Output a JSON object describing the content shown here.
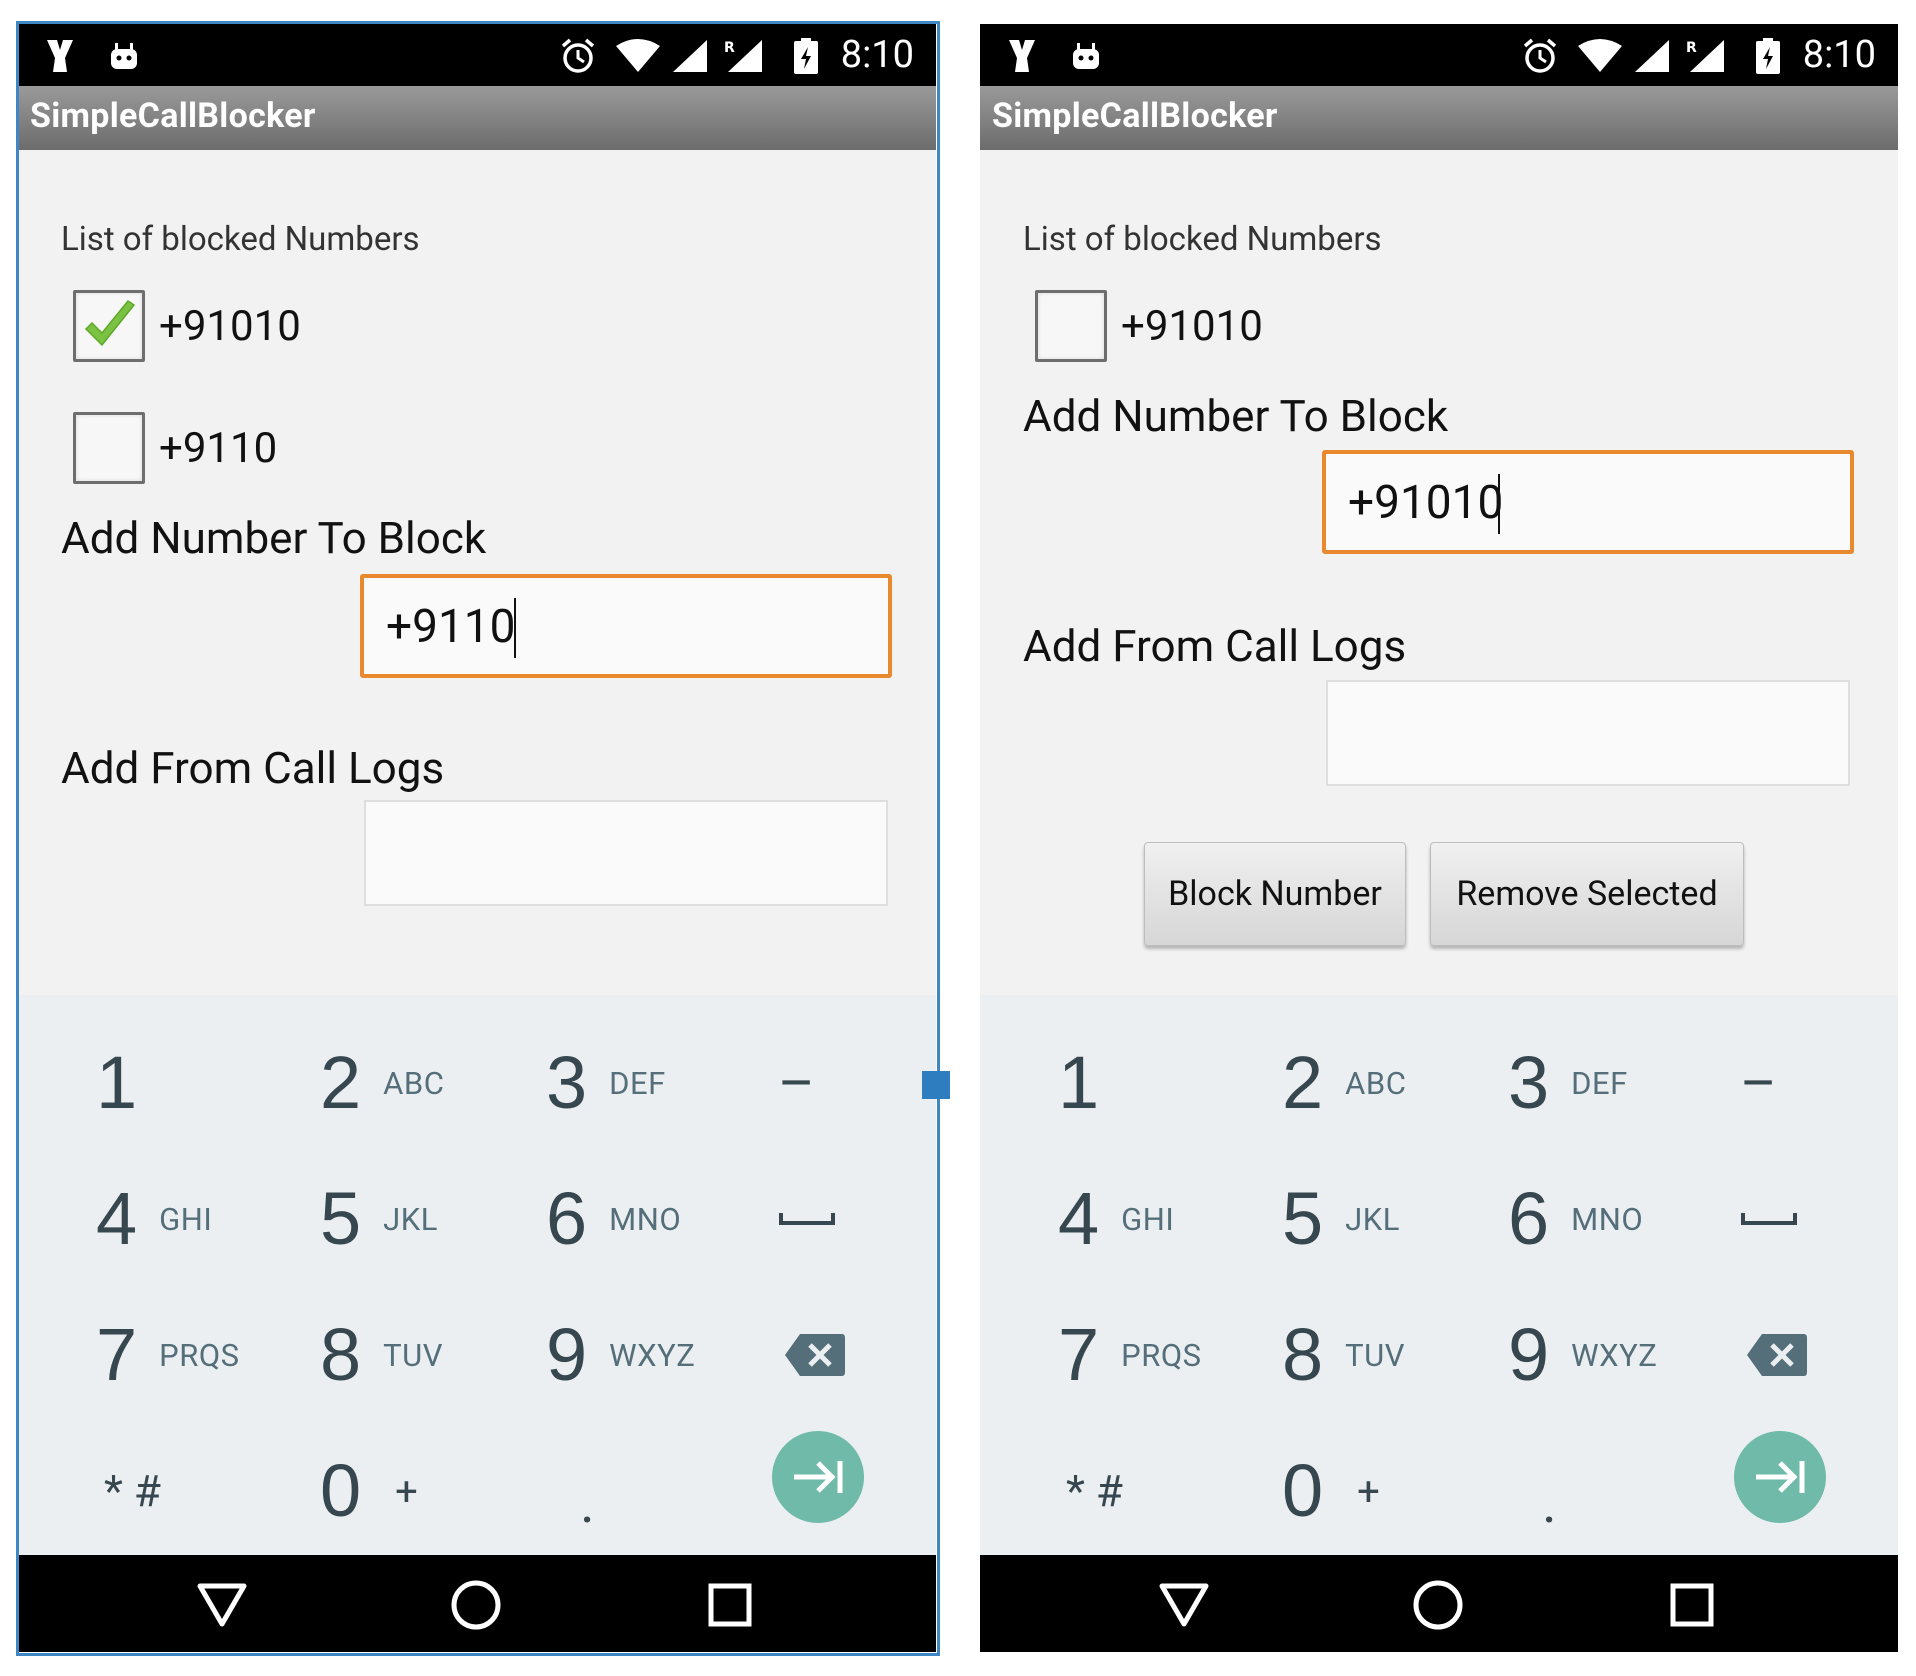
{
  "status_bar": {
    "time": "8:10"
  },
  "app": {
    "title": "SimpleCallBlocker"
  },
  "screens": [
    {
      "blocked_header": "List of blocked Numbers",
      "blocked": [
        {
          "number": "+91010",
          "checked": true
        },
        {
          "number": "+9110",
          "checked": false
        }
      ],
      "add_label": "Add Number To Block",
      "input_value": "+9110",
      "call_logs_label": "Add From Call Logs",
      "call_logs_value": ""
    },
    {
      "blocked_header": "List of blocked Numbers",
      "blocked": [
        {
          "number": "+91010",
          "checked": false
        }
      ],
      "add_label": "Add Number To Block",
      "input_value": "+91010",
      "call_logs_label": "Add From Call Logs",
      "call_logs_value": "",
      "buttons": {
        "block": "Block Number",
        "remove": "Remove Selected"
      }
    }
  ],
  "keypad": {
    "keys": [
      {
        "digit": "1",
        "letters": ""
      },
      {
        "digit": "2",
        "letters": "ABC"
      },
      {
        "digit": "3",
        "letters": "DEF"
      },
      {
        "digit": "4",
        "letters": "GHI"
      },
      {
        "digit": "5",
        "letters": "JKL"
      },
      {
        "digit": "6",
        "letters": "MNO"
      },
      {
        "digit": "7",
        "letters": "PRQS"
      },
      {
        "digit": "8",
        "letters": "TUV"
      },
      {
        "digit": "9",
        "letters": "WXYZ"
      },
      {
        "digit": "0",
        "letters": "+"
      }
    ],
    "minus": "–",
    "star_hash": "* #",
    "dot": "."
  },
  "colors": {
    "input_focus_border": "#e8892e",
    "fab": "#6fbaa9",
    "check": "#7cc242",
    "frame_selection": "#3f86c5"
  },
  "icons": [
    "dolby-icon",
    "android-icon",
    "alarm-icon",
    "wifi-icon",
    "signal-icon",
    "roaming-signal-icon",
    "battery-icon",
    "backspace-icon",
    "space-icon",
    "next-icon",
    "back-icon",
    "home-icon",
    "recents-icon"
  ]
}
